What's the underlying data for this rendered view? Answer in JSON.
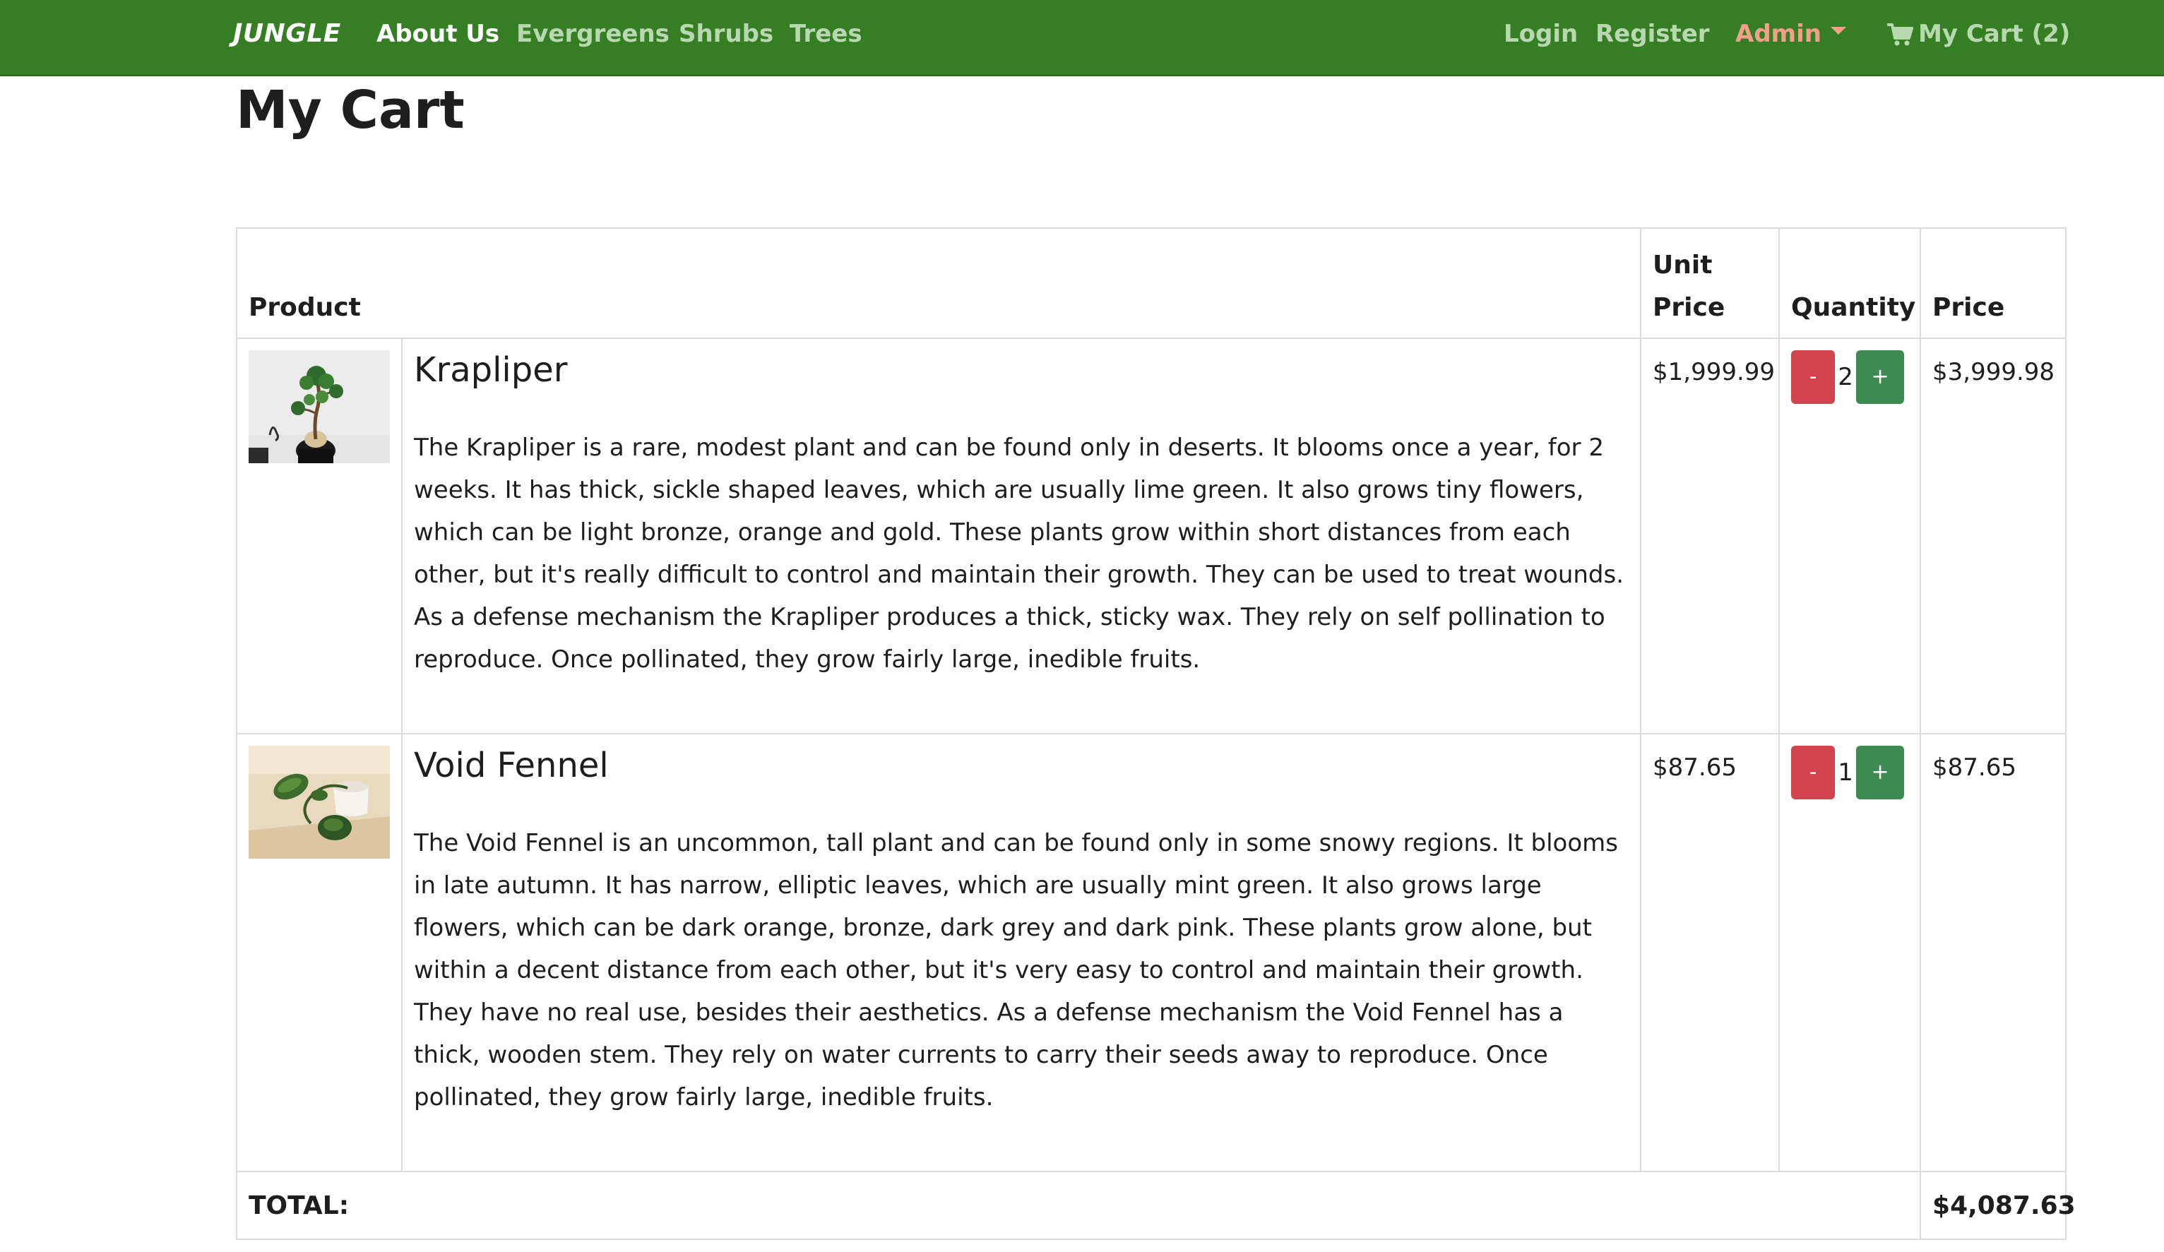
{
  "nav": {
    "brand": "JUNGLE",
    "links": [
      "About Us",
      "Evergreens",
      "Shrubs",
      "Trees"
    ],
    "login": "Login",
    "register": "Register",
    "admin": "Admin",
    "cart": "My Cart (2)"
  },
  "page": {
    "title": "My Cart"
  },
  "table": {
    "headers": {
      "product": "Product",
      "unit_price_line1": "Unit",
      "unit_price_line2": "Price",
      "quantity": "Quantity",
      "price": "Price"
    },
    "items": [
      {
        "image": "bonsai-plant-photo",
        "name": "Krapliper",
        "description": "The Krapliper is a rare, modest plant and can be found only in deserts. It blooms once a year, for 2 weeks. It has thick, sickle shaped leaves, which are usually lime green. It also grows tiny flowers, which can be light bronze, orange and gold. These plants grow within short distances from each other, but it's really difficult to control and maintain their growth. They can be used to treat wounds. As a defense mechanism the Krapliper produces a thick, sticky wax. They rely on self pollination to reproduce. Once pollinated, they grow fairly large, inedible fruits.",
        "unit_price": "$1,999.99",
        "quantity": "2",
        "price": "$3,999.98",
        "minus_label": "-",
        "plus_label": "+"
      },
      {
        "image": "vine-plant-photo",
        "name": "Void Fennel",
        "description": "The Void Fennel is an uncommon, tall plant and can be found only in some snowy regions. It blooms in late autumn. It has narrow, elliptic leaves, which are usually mint green. It also grows large flowers, which can be dark orange, bronze, dark grey and dark pink. These plants grow alone, but within a decent distance from each other, but it's very easy to control and maintain their growth. They have no real use, besides their aesthetics. As a defense mechanism the Void Fennel has a thick, wooden stem. They rely on water currents to carry their seeds away to reproduce. Once pollinated, they grow fairly large, inedible fruits.",
        "unit_price": "$87.65",
        "quantity": "1",
        "price": "$87.65",
        "minus_label": "-",
        "plus_label": "+"
      }
    ],
    "total_label": "TOTAL:",
    "total_value": "$4,087.63"
  },
  "colors": {
    "navbar": "#367e24",
    "nav_active": "#ffffff",
    "nav_muted": "#b8d9b0",
    "admin": "#f2a08a",
    "minus_button": "#d2434b",
    "plus_button": "#3d8a52"
  },
  "icons": {
    "cart": "shopping-cart-icon",
    "admin_dropdown": "caret-down-icon"
  }
}
